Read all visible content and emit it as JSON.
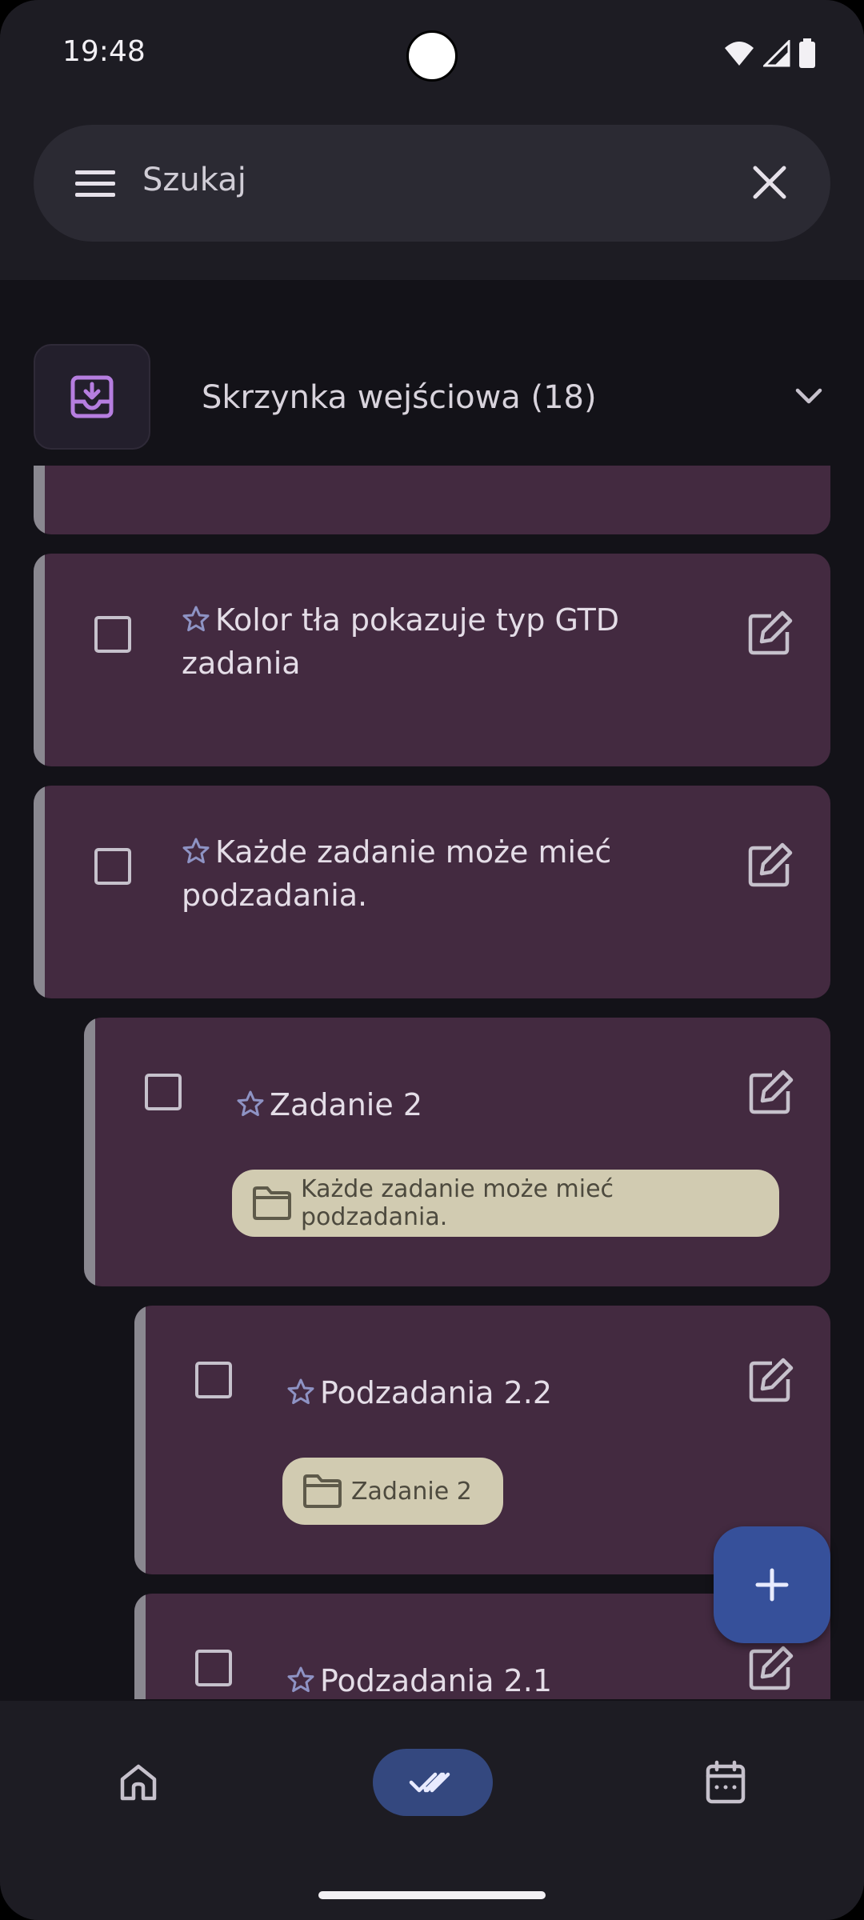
{
  "status_bar": {
    "time": "19:48"
  },
  "search": {
    "placeholder": "Szukaj"
  },
  "inbox": {
    "title": "Skrzynka wejściowa (18)"
  },
  "tasks": [
    {
      "title": "Kolor tła pokazuje typ GTD zadania",
      "title_line1": "Kolor tła pokazuje typ GTD",
      "title_line2": "zadania"
    },
    {
      "title": "Każde zadanie może mieć podzadania.",
      "title_line1": "Każde zadanie może mieć",
      "title_line2": "podzadania."
    },
    {
      "title": "Zadanie 2",
      "parent_chip": "Każde zadanie może mieć podzadania."
    },
    {
      "title": "Podzadania 2.2",
      "parent_chip": "Zadanie 2"
    },
    {
      "title": "Podzadania 2.1"
    }
  ],
  "colors": {
    "background": "#131218",
    "task_card": "#432a40",
    "chip": "#d1cbb1",
    "fab": "#36509a",
    "nav_active": "#34487f",
    "inbox_accent": "#b67ee0"
  },
  "icons": {
    "menu": "menu-icon",
    "clear": "close-icon",
    "inbox": "inbox-download-icon",
    "chevron": "chevron-down-icon",
    "star": "star-outline-icon",
    "edit": "edit-icon",
    "folder": "folder-icon",
    "add": "add-icon",
    "home": "home-icon",
    "tasks": "double-check-icon",
    "calendar": "calendar-icon"
  }
}
